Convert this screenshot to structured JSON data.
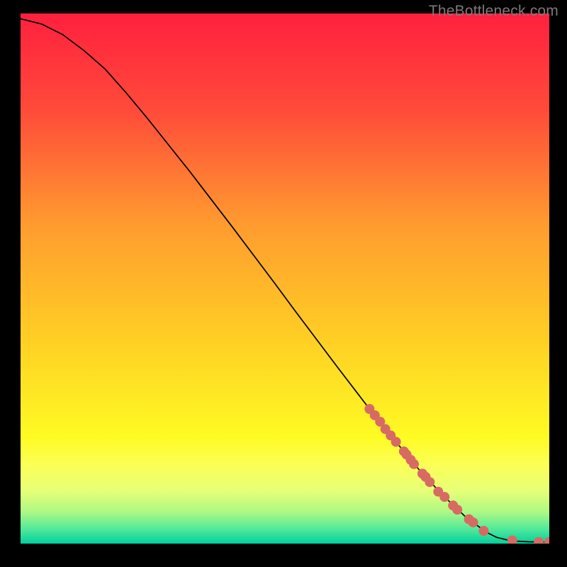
{
  "source_label": "TheBottleneck.com",
  "gradient": {
    "stops": [
      {
        "offset": "0%",
        "color": "#ff203e"
      },
      {
        "offset": "18%",
        "color": "#ff4a3a"
      },
      {
        "offset": "40%",
        "color": "#ff9c2f"
      },
      {
        "offset": "62%",
        "color": "#ffd024"
      },
      {
        "offset": "80%",
        "color": "#fefb23"
      },
      {
        "offset": "85%",
        "color": "#fcff55"
      },
      {
        "offset": "90%",
        "color": "#e7ff77"
      },
      {
        "offset": "94%",
        "color": "#aef884"
      },
      {
        "offset": "97%",
        "color": "#59eb99"
      },
      {
        "offset": "100%",
        "color": "#00d09e"
      }
    ]
  },
  "dot_style": {
    "radius": 7,
    "fill": "#d86a64"
  },
  "chart_data": {
    "type": "line",
    "title": "",
    "xlabel": "",
    "ylabel": "",
    "xlim": [
      0,
      100
    ],
    "ylim": [
      0,
      100
    ],
    "series": [
      {
        "name": "curve",
        "x": [
          0,
          4,
          8,
          12,
          16,
          20,
          24,
          28,
          32,
          36,
          40,
          44,
          48,
          52,
          56,
          60,
          64,
          68,
          72,
          76,
          80,
          84,
          88,
          90,
          92,
          94,
          96,
          98,
          100
        ],
        "y": [
          99,
          98,
          96,
          93,
          89.5,
          85,
          80.2,
          75.2,
          70.2,
          65,
          59.8,
          54.5,
          49.2,
          43.8,
          38.5,
          33.2,
          28,
          22.8,
          18,
          13.2,
          9,
          5.2,
          2.2,
          1.2,
          0.7,
          0.45,
          0.35,
          0.3,
          0.3
        ]
      }
    ],
    "highlighted_points": {
      "name": "dots",
      "x": [
        66,
        67,
        68,
        69,
        70,
        71,
        72.5,
        73,
        73.8,
        74.4,
        76,
        76.6,
        77.4,
        79,
        80.2,
        81.8,
        82.6,
        84.8,
        85.6,
        87.6,
        93,
        98,
        100
      ],
      "y": [
        25.4,
        24.2,
        23,
        21.6,
        20.4,
        19.2,
        17.4,
        16.8,
        15.8,
        15,
        13.2,
        12.6,
        11.6,
        9.8,
        8.8,
        7.2,
        6.4,
        4.6,
        4,
        2.4,
        0.6,
        0.3,
        0.3
      ]
    },
    "legend": false,
    "grid": false
  }
}
